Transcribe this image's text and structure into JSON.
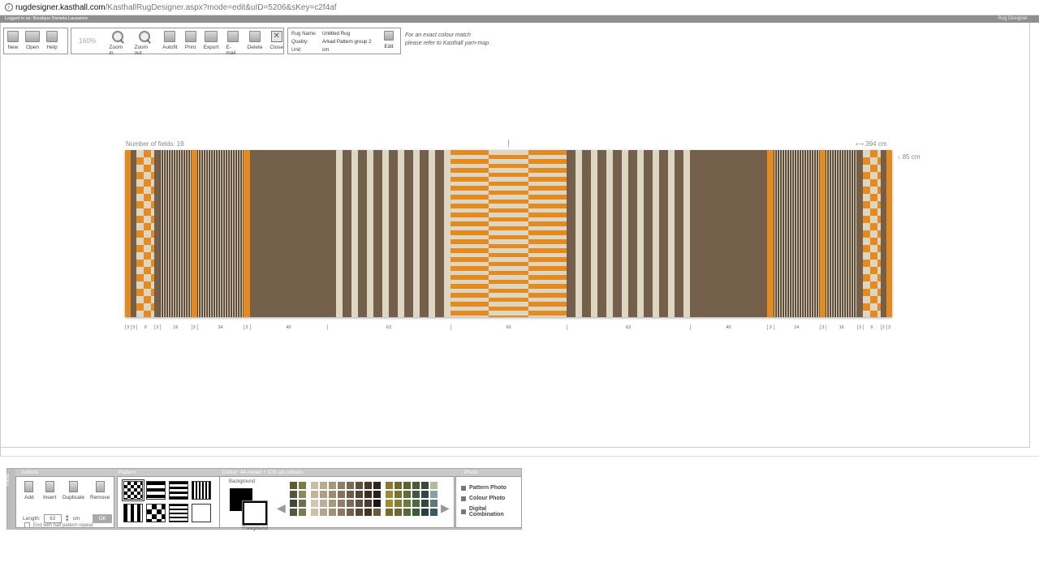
{
  "browser": {
    "url_host": "rugdesigner.kasthall.com",
    "url_path": "/KasthallRugDesigner.aspx?mode=edit&uID=5206&sKey=c2f4af"
  },
  "status": {
    "logged_in": "Logged in as: Boutique Daniela Lausanne",
    "app_name": "Rug Designer"
  },
  "toolbar": {
    "new": "New",
    "open": "Open",
    "help": "Help",
    "zoom_level": "160%",
    "zoom_in": "Zoom in",
    "zoom_out": "Zoom out",
    "autofit": "Autofit",
    "print": "Print",
    "export": "Export",
    "email": "E-mail",
    "delete": "Delete",
    "close": "Close"
  },
  "rug_info": {
    "name_label": "Rug Name:",
    "name": "Untitled Rug",
    "quality_label": "Quality:",
    "quality": "Arkad Pattern group 2",
    "unit_label": "Unit:",
    "unit": "cm",
    "edit": "Edit"
  },
  "colour_note": {
    "line1": "For an exact colour match",
    "line2": "please refer to Kasthall yarn-map."
  },
  "rug": {
    "fields_label": "Number of fields: 19",
    "width_label": "394 cm",
    "height_label": "85 cm",
    "segments": [
      {
        "type": "orange",
        "cm": 3
      },
      {
        "type": "brown",
        "cm": 3
      },
      {
        "type": "checker",
        "cm": 9
      },
      {
        "type": "brown",
        "cm": 3
      },
      {
        "type": "fine",
        "cm": 16
      },
      {
        "type": "orange",
        "cm": 3
      },
      {
        "type": "fine",
        "cm": 24
      },
      {
        "type": "orange",
        "cm": 3
      },
      {
        "type": "brown",
        "cm": 40
      },
      {
        "type": "stripes",
        "cm": 63
      },
      {
        "type": "blocks",
        "cm": 60
      },
      {
        "type": "stripes",
        "cm": 63
      },
      {
        "type": "brown",
        "cm": 40
      },
      {
        "type": "orange",
        "cm": 3
      },
      {
        "type": "fine",
        "cm": 24
      },
      {
        "type": "orange",
        "cm": 3
      },
      {
        "type": "fine",
        "cm": 16
      },
      {
        "type": "brown",
        "cm": 3
      },
      {
        "type": "checker",
        "cm": 9
      },
      {
        "type": "brown",
        "cm": 3
      },
      {
        "type": "orange",
        "cm": 3
      }
    ],
    "scale_labels": [
      "3",
      "3",
      "9",
      "3",
      "16",
      "3",
      "24",
      "3",
      "40",
      "63",
      "60",
      "63",
      "40",
      "3",
      "24",
      "3",
      "16",
      "3",
      "9",
      "3",
      "3"
    ]
  },
  "panel": {
    "tab_label": "Field",
    "actions_title": "Actions",
    "add": "Add",
    "insert": "Insert",
    "duplicate": "Duplicate",
    "remove": "Remove",
    "length_label": "Length:",
    "length_value": "63",
    "length_unit": "cm",
    "ok": "OK",
    "half_repeat": "End with half pattern repeat",
    "pattern_title": "Pattern",
    "colour_title": "Colour: 44 mixed + 123 uni colours",
    "background": "Background",
    "foreground": "Foreground",
    "photo_title": "Photo",
    "photo_items": [
      "Pattern Photo",
      "Colour Photo",
      "Digital Combination"
    ]
  },
  "colors": {
    "orange": "#e48a1f",
    "brown": "#74604a",
    "cream": "#ddd6c2",
    "dark": "#4e3e2d"
  }
}
